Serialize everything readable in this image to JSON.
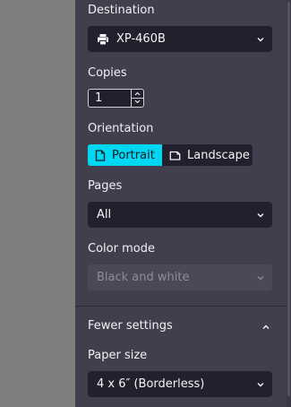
{
  "print_settings": {
    "destination": {
      "label": "Destination",
      "value": "XP-460B",
      "icon": "printer-icon"
    },
    "copies": {
      "label": "Copies",
      "value": "1"
    },
    "orientation": {
      "label": "Orientation",
      "options": [
        "Portrait",
        "Landscape"
      ],
      "selected": "Portrait"
    },
    "pages": {
      "label": "Pages",
      "value": "All"
    },
    "color_mode": {
      "label": "Color mode",
      "value": "Black and white",
      "disabled": true
    },
    "toggle_settings": {
      "label": "Fewer settings",
      "icon": "chevron-up-icon"
    },
    "paper_size": {
      "label": "Paper size",
      "value": "4 x 6″ (Borderless)"
    }
  },
  "colors": {
    "panel_background": "#413f4d",
    "control_background": "#22202c",
    "accent": "#00d7f2",
    "preview_background": "#7f7f7f"
  }
}
